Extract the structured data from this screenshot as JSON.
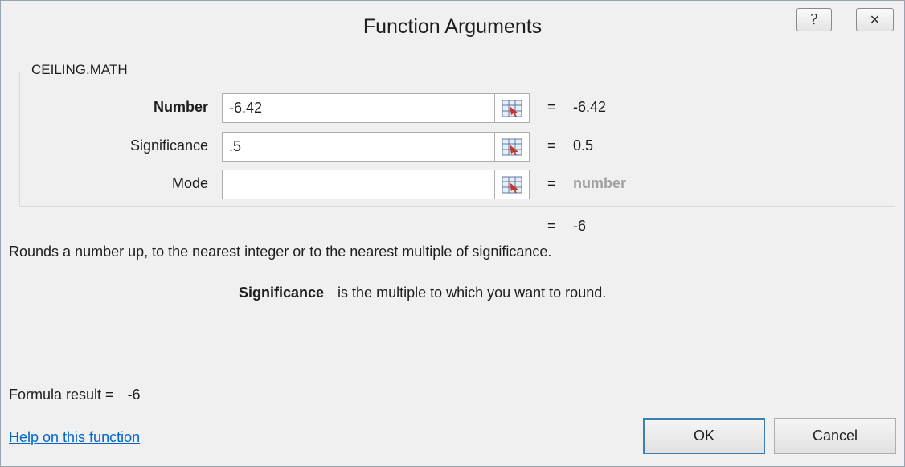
{
  "window": {
    "title": "Function Arguments",
    "help_glyph": "?",
    "close_glyph": "✕"
  },
  "function_name": "CEILING.MATH",
  "arguments": [
    {
      "label": "Number",
      "value": "-6.42",
      "equals": "=",
      "result": "-6.42",
      "bold": true
    },
    {
      "label": "Significance",
      "value": ".5",
      "equals": "=",
      "result": "0.5",
      "bold": false
    },
    {
      "label": "Mode",
      "value": "",
      "equals": "=",
      "result": "number",
      "bold": false
    }
  ],
  "overall_result": {
    "equals": "=",
    "value": "-6"
  },
  "description": "Rounds a number up, to the nearest integer or to the nearest multiple of significance.",
  "arg_help": {
    "name": "Significance",
    "text": "is the multiple to which you want to round."
  },
  "formula_result": {
    "label": "Formula result =",
    "value": "-6"
  },
  "footer": {
    "help_link": "Help on this function",
    "ok_label": "OK",
    "cancel_label": "Cancel"
  },
  "icons": {
    "help": "help-icon",
    "close": "close-icon",
    "range_selector": "collapse-dialog-icon"
  },
  "colors": {
    "link": "#0066cc",
    "placeholder": "#a0a0a0",
    "ok_border": "#3c7fb1"
  }
}
